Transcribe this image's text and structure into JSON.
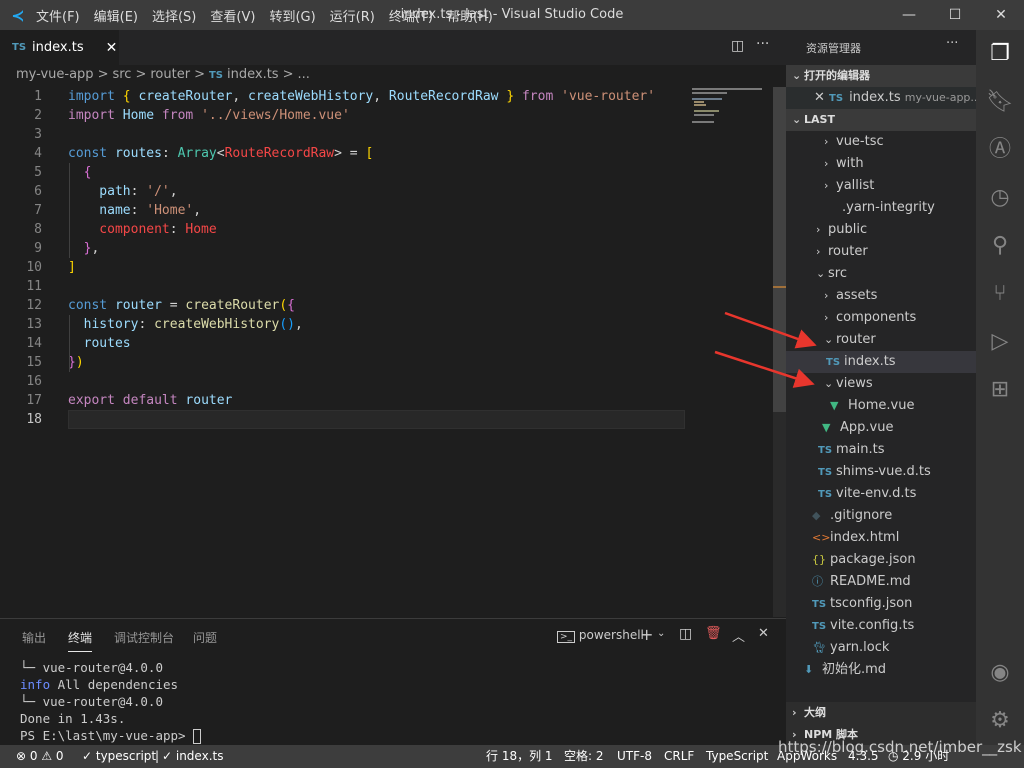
{
  "titlebar": {
    "menus": [
      "文件(F)",
      "编辑(E)",
      "选择(S)",
      "查看(V)",
      "转到(G)",
      "运行(R)",
      "终端(T)",
      "帮助(H)"
    ],
    "title": "index.ts - last - Visual Studio Code"
  },
  "editor": {
    "tab": {
      "label": "index.ts",
      "icon": "TS"
    },
    "breadcrumb": [
      "my-vue-app",
      ">",
      "src",
      ">",
      "router",
      ">",
      "TS",
      "index.ts",
      ">",
      "..."
    ],
    "lines": [
      [
        [
          "import ",
          "k"
        ],
        [
          "{ ",
          "br"
        ],
        [
          "createRouter",
          "v"
        ],
        [
          ", ",
          ""
        ],
        [
          "createWebHistory",
          "v"
        ],
        [
          ", ",
          ""
        ],
        [
          "RouteRecordRaw",
          "v"
        ],
        [
          " }",
          "br"
        ],
        [
          " from ",
          "p"
        ],
        [
          "'vue-router'",
          "s"
        ]
      ],
      [
        [
          "import ",
          "p"
        ],
        [
          "Home",
          "v"
        ],
        [
          " from ",
          "p"
        ],
        [
          "'../views/Home.vue'",
          "s"
        ]
      ],
      [],
      [
        [
          "const ",
          "k"
        ],
        [
          "routes",
          "v"
        ],
        [
          ": ",
          ""
        ],
        [
          "Array",
          "t"
        ],
        [
          "<",
          ""
        ],
        [
          "RouteRecordRaw",
          "r"
        ],
        [
          "> = ",
          ""
        ],
        [
          "[",
          "br"
        ]
      ],
      [
        [
          "  {",
          "br2"
        ]
      ],
      [
        [
          "    path",
          "v"
        ],
        [
          ": ",
          ""
        ],
        [
          "'/'",
          "s"
        ],
        [
          ",",
          ""
        ]
      ],
      [
        [
          "    name",
          "v"
        ],
        [
          ": ",
          ""
        ],
        [
          "'Home'",
          "s"
        ],
        [
          ",",
          ""
        ]
      ],
      [
        [
          "    component",
          "r"
        ],
        [
          ": ",
          ""
        ],
        [
          "Home",
          "r"
        ]
      ],
      [
        [
          "  }",
          "br2"
        ],
        [
          ",",
          ""
        ]
      ],
      [
        [
          "]",
          "br"
        ]
      ],
      [],
      [
        [
          "const ",
          "k"
        ],
        [
          "router",
          "v"
        ],
        [
          " = ",
          ""
        ],
        [
          "createRouter",
          "f"
        ],
        [
          "(",
          "br"
        ],
        [
          "{",
          "br2"
        ]
      ],
      [
        [
          "  history",
          "v"
        ],
        [
          ": ",
          ""
        ],
        [
          "createWebHistory",
          "f"
        ],
        [
          "()",
          "br3"
        ],
        [
          ",",
          ""
        ]
      ],
      [
        [
          "  routes",
          "v"
        ]
      ],
      [
        [
          "}",
          "br2"
        ],
        [
          ")",
          "br"
        ]
      ],
      [],
      [
        [
          "export ",
          "p"
        ],
        [
          "default ",
          "p"
        ],
        [
          "router",
          "v"
        ]
      ],
      []
    ]
  },
  "panel": {
    "tabs": [
      "输出",
      "终端",
      "调试控制台",
      "问题"
    ],
    "active_tab": "终端",
    "shell": "powershell",
    "terminal": [
      [
        "└─ vue-router@4.0.0",
        ""
      ],
      [
        "info",
        " All dependencies"
      ],
      [
        "└─ vue-router@4.0.0",
        ""
      ],
      [
        "Done in 1.43s.",
        ""
      ],
      [
        "PS E:\\last\\my-vue-app> ",
        ""
      ]
    ]
  },
  "sidebar": {
    "title": "资源管理器",
    "open_editors": "打开的编辑器",
    "open_file": "index.ts",
    "open_file_path": "my-vue-app...",
    "root": "LAST",
    "tree": [
      {
        "label": "vue-tsc",
        "indent": 38,
        "icon": "chevron-right"
      },
      {
        "label": "with",
        "indent": 38,
        "icon": "chevron-right"
      },
      {
        "label": "yallist",
        "indent": 38,
        "icon": "chevron-right"
      },
      {
        "label": ".yarn-integrity",
        "indent": 38,
        "icon": "file"
      },
      {
        "label": "public",
        "indent": 30,
        "icon": "chevron-right"
      },
      {
        "label": "router",
        "indent": 30,
        "icon": "chevron-right"
      },
      {
        "label": "src",
        "indent": 30,
        "icon": "chevron-down"
      },
      {
        "label": "assets",
        "indent": 38,
        "icon": "chevron-right"
      },
      {
        "label": "components",
        "indent": 38,
        "icon": "chevron-right"
      },
      {
        "label": "router",
        "indent": 38,
        "icon": "chevron-down"
      },
      {
        "label": "index.ts",
        "indent": 40,
        "icon": "ts",
        "selected": true
      },
      {
        "label": "views",
        "indent": 38,
        "icon": "chevron-down"
      },
      {
        "label": "Home.vue",
        "indent": 44,
        "icon": "vue"
      },
      {
        "label": "App.vue",
        "indent": 36,
        "icon": "vue"
      },
      {
        "label": "main.ts",
        "indent": 32,
        "icon": "ts"
      },
      {
        "label": "shims-vue.d.ts",
        "indent": 32,
        "icon": "ts"
      },
      {
        "label": "vite-env.d.ts",
        "indent": 32,
        "icon": "ts"
      },
      {
        "label": ".gitignore",
        "indent": 26,
        "icon": "git"
      },
      {
        "label": "index.html",
        "indent": 26,
        "icon": "html"
      },
      {
        "label": "package.json",
        "indent": 26,
        "icon": "json"
      },
      {
        "label": "README.md",
        "indent": 26,
        "icon": "info"
      },
      {
        "label": "tsconfig.json",
        "indent": 26,
        "icon": "ts"
      },
      {
        "label": "vite.config.ts",
        "indent": 26,
        "icon": "ts"
      },
      {
        "label": "yarn.lock",
        "indent": 26,
        "icon": "yarn"
      },
      {
        "label": "初始化.md",
        "indent": 18,
        "icon": "md"
      }
    ],
    "outline": "大纲",
    "npm": "NPM 脚本"
  },
  "statusbar": {
    "errors": "0",
    "warnings": "0",
    "ts_check": "✓ typescript",
    "file_check": "✓ index.ts",
    "position": "行 18，列 1",
    "spaces": "空格: 2",
    "encoding": "UTF-8",
    "eol": "CRLF",
    "language": "TypeScript",
    "appworks": "AppWorks",
    "version": "4.3.5",
    "time": "2.9 小时"
  },
  "watermark": "https://blog.csdn.net/imber__zsk",
  "colors": {
    "titlebar": "#3c3c3c",
    "editor": "#1e1e1e",
    "sidebar": "#252526",
    "activity": "#333333",
    "arrow": "#e8362d",
    "ts": "#519aba",
    "vue": "#41b883"
  }
}
